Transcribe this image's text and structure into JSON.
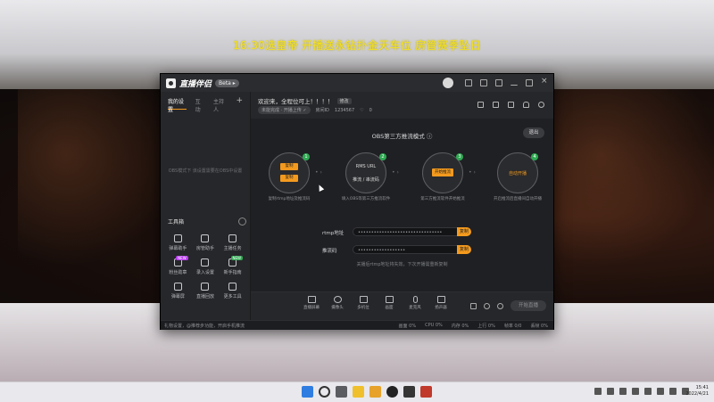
{
  "stream_title": "16:30选皇帝  开播送永钻扑金天车位  房管赛季坠日",
  "app": {
    "logo_text": "直播伴侣",
    "version_pill": "Beta ▸",
    "left_tabs": [
      "我的设置",
      "互动",
      "主持人"
    ],
    "left_empty_text": "OBS模式下 该设置需要在OBS中设置",
    "tools_title": "工具箱",
    "tools": [
      {
        "label": "弹幕助手",
        "icon": "danmu-icon",
        "badge": ""
      },
      {
        "label": "房管助手",
        "icon": "manager-icon",
        "badge": ""
      },
      {
        "label": "主播任务",
        "icon": "task-icon",
        "badge": ""
      },
      {
        "label": "粉丝勋章",
        "icon": "medal-icon",
        "badge": "NEW"
      },
      {
        "label": "录入设置",
        "icon": "download-icon",
        "badge": ""
      },
      {
        "label": "新手指南",
        "icon": "guide-icon",
        "badge": "NEW"
      },
      {
        "label": "弹幕屏",
        "icon": "screen-icon",
        "badge": ""
      },
      {
        "label": "直播回放",
        "icon": "replay-icon",
        "badge": ""
      },
      {
        "label": "更多工具",
        "icon": "more-tools-icon",
        "badge": ""
      }
    ],
    "room": {
      "title": "欢迎来，全程位可上！！！！",
      "edit": "修改",
      "category": "未能完成 · 开播上传 ✓",
      "room_id_label": "房间ID",
      "room_id": "1234567",
      "likes": "0"
    },
    "mode_title": "OBS第三方推流模式 ⓘ",
    "exit_label": "退出",
    "steps": [
      {
        "num": "1",
        "chip_a": "复制",
        "chip_b": "复制",
        "label": "复制rtmp地址及推流码"
      },
      {
        "num": "2",
        "text_a": "RMS URL",
        "text_b": "推流 / 串流码",
        "label": "填入OBS等第三方推流软件"
      },
      {
        "num": "3",
        "chip": "开始推流",
        "label": "第三方推流软件开始推流"
      },
      {
        "num": "4",
        "text": "自动开播",
        "label": "开启推流后直播间自动开播"
      }
    ],
    "rtmp": {
      "label": "rtmp地址",
      "value": "••••••••••••••••••••••••••••••••",
      "copy": "复制"
    },
    "stream_key": {
      "label": "推流码",
      "value": "••••••••••••••••••",
      "copy": "复制"
    },
    "hint": "关播后rtmp地址将失效，下次开播需重新复制",
    "bottom_tools": [
      "直播屏幕",
      "摄像头",
      "多机位",
      "画面",
      "麦克风",
      "扬声器"
    ],
    "go_live": "开始直播",
    "status_left": "礼物设置，@推荐步功能，开启手机推流",
    "status_right": [
      "画面 0%",
      "CPU 0%",
      "内存 0%",
      "上行 0%",
      "帧率 0/0",
      "丢帧 0%"
    ]
  },
  "taskbar": {
    "time": "15:41",
    "date": "2022/4/21"
  }
}
